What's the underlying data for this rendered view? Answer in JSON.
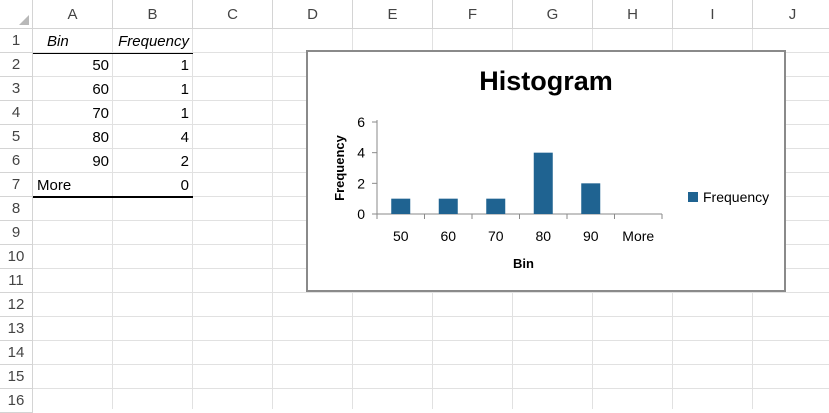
{
  "columns": [
    "A",
    "B",
    "C",
    "D",
    "E",
    "F",
    "G",
    "H",
    "I",
    "J"
  ],
  "rows": [
    "1",
    "2",
    "3",
    "4",
    "5",
    "6",
    "7",
    "8",
    "9",
    "10",
    "11",
    "12",
    "13",
    "14",
    "15",
    "16"
  ],
  "table": {
    "headers": [
      "Bin",
      "Frequency"
    ],
    "rows": [
      {
        "bin": "50",
        "freq": "1"
      },
      {
        "bin": "60",
        "freq": "1"
      },
      {
        "bin": "70",
        "freq": "1"
      },
      {
        "bin": "80",
        "freq": "4"
      },
      {
        "bin": "90",
        "freq": "2"
      },
      {
        "bin": "More",
        "freq": "0"
      }
    ]
  },
  "chart_data": {
    "type": "bar",
    "title": "Histogram",
    "categories": [
      "50",
      "60",
      "70",
      "80",
      "90",
      "More"
    ],
    "series": [
      {
        "name": "Frequency",
        "values": [
          1,
          1,
          1,
          4,
          2,
          0
        ],
        "color": "#1f6391"
      }
    ],
    "xlabel": "Bin",
    "ylabel": "Frequency",
    "ylim": [
      0,
      6
    ],
    "yticks": [
      0,
      2,
      4,
      6
    ],
    "legend": "right",
    "grid": false
  },
  "colors": {
    "bar": "#1f6391",
    "axis": "#8a8a8a"
  }
}
